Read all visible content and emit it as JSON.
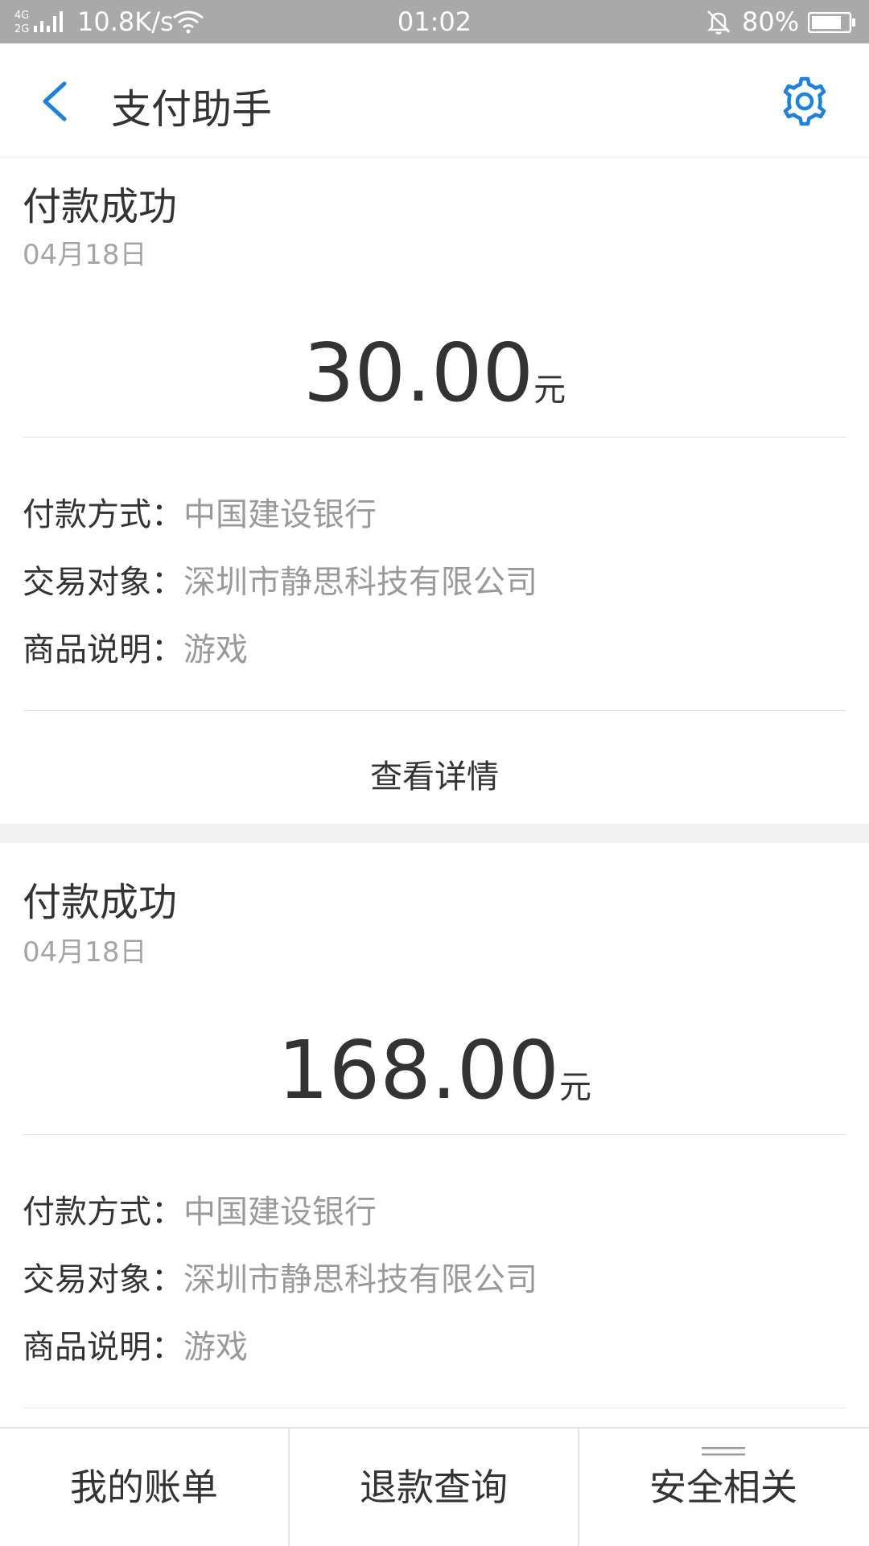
{
  "status_bar": {
    "network": "4G 2G",
    "speed": "10.8K/s",
    "time": "01:02",
    "battery": "80%"
  },
  "header": {
    "title": "支付助手",
    "accent_color": "#1a82e2"
  },
  "cards": [
    {
      "status": "付款成功",
      "date": "04月18日",
      "amount": "30.00",
      "unit": "元",
      "rows": [
        {
          "label": "付款方式：",
          "value": "中国建设银行"
        },
        {
          "label": "交易对象：",
          "value": "深圳市静思科技有限公司"
        },
        {
          "label": "商品说明：",
          "value": "游戏"
        }
      ],
      "details_label": "查看详情"
    },
    {
      "status": "付款成功",
      "date": "04月18日",
      "amount": "168.00",
      "unit": "元",
      "rows": [
        {
          "label": "付款方式：",
          "value": "中国建设银行"
        },
        {
          "label": "交易对象：",
          "value": "深圳市静思科技有限公司"
        },
        {
          "label": "商品说明：",
          "value": "游戏"
        }
      ]
    }
  ],
  "bottom_nav": [
    "我的账单",
    "退款查询",
    "安全相关"
  ]
}
